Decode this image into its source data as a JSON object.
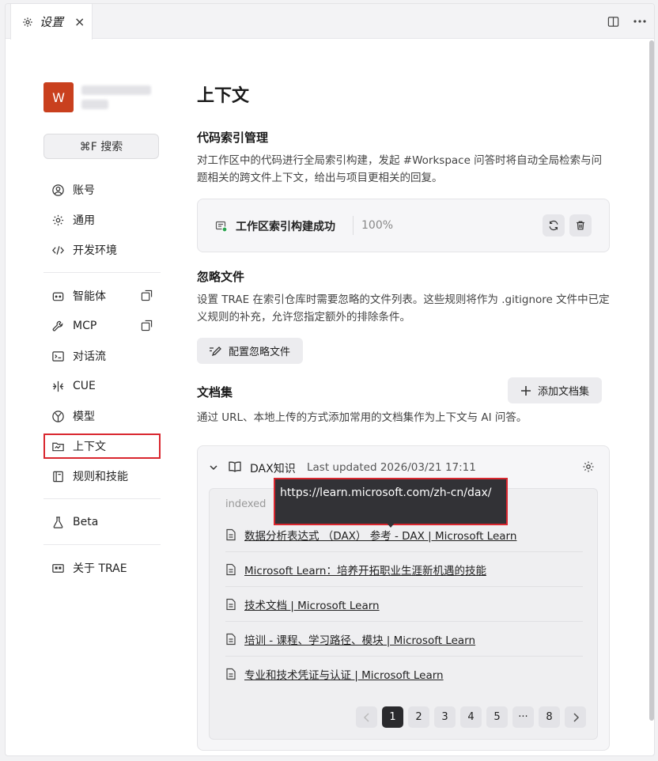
{
  "tab": {
    "title": "设置",
    "close": "×"
  },
  "profile": {
    "avatar_letter": "W"
  },
  "search": {
    "label": "⌘F 搜索"
  },
  "nav": {
    "account": "账号",
    "general": "通用",
    "dev_env": "开发环境",
    "agent": "智能体",
    "mcp": "MCP",
    "flow": "对话流",
    "cue": "CUE",
    "model": "模型",
    "context": "上下文",
    "rules": "规则和技能",
    "beta": "Beta",
    "about": "关于 TRAE"
  },
  "main": {
    "title": "上下文",
    "index": {
      "title": "代码索引管理",
      "desc": "对工作区中的代码进行全局索引构建，发起 #Workspace 问答时将自动全局检索与问题相关的跨文件上下文，给出与项目更相关的回复。",
      "status": "工作区索引构建成功",
      "progress": "100%"
    },
    "ignore": {
      "title": "忽略文件",
      "desc": "设置 TRAE 在索引仓库时需要忽略的文件列表。这些规则将作为 .gitignore 文件中已定义规则的补充，允许您指定额外的排除条件。",
      "button": "配置忽略文件"
    },
    "docs": {
      "title": "文档集",
      "add_button": "添加文档集",
      "desc": "通过 URL、本地上传的方式添加常用的文档集作为上下文与 AI 问答。",
      "set_name": "DAX知识",
      "updated": "Last updated 2026/03/21 17:11",
      "indexed_label": "indexed",
      "tooltip": "https://learn.microsoft.com/zh-cn/dax/",
      "links": [
        "数据分析表达式 （DAX） 参考 - DAX | Microsoft Learn",
        "Microsoft Learn：培养开拓职业生涯新机遇的技能",
        "技术文档 | Microsoft Learn",
        "培训 - 课程、学习路径、模块 | Microsoft Learn",
        "专业和技术凭证与认证 | Microsoft Learn"
      ],
      "pages": [
        "1",
        "2",
        "3",
        "4",
        "5",
        "···",
        "8"
      ],
      "current_page": "1"
    }
  },
  "colors": {
    "accent_red": "#d9262e",
    "avatar": "#c9401e",
    "tooltip_bg": "#323236"
  }
}
